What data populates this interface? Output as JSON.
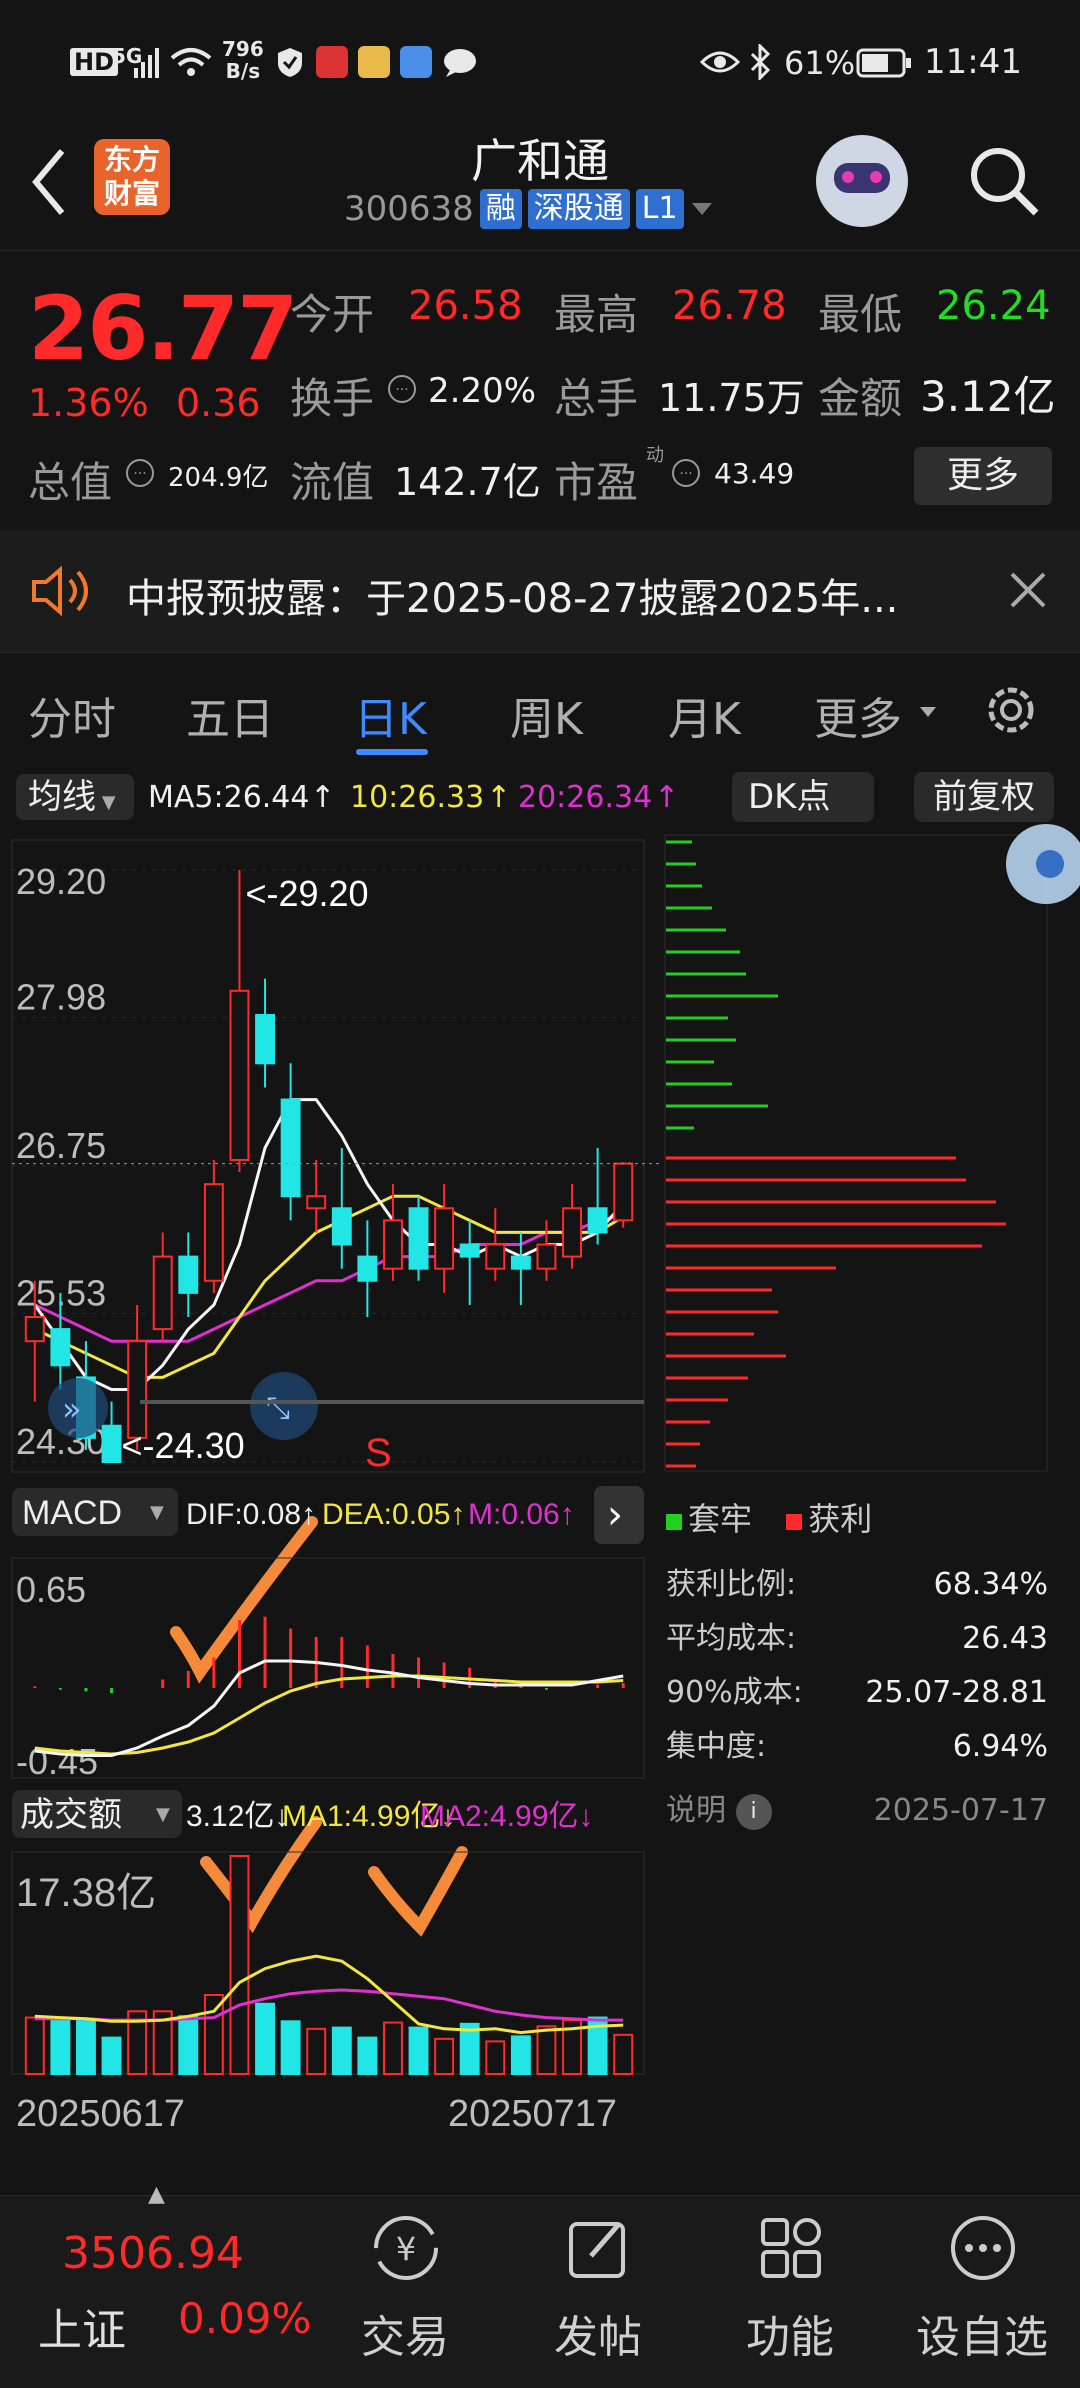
{
  "status_bar": {
    "time": "11:41",
    "battery": "61%",
    "net_speed_value": "796",
    "net_speed_unit": "B/s",
    "hd": "HD",
    "signal": "5G"
  },
  "header": {
    "logo_line1": "东方",
    "logo_line2": "财富",
    "stock_name": "广和通",
    "stock_code": "300638",
    "tag_rong": "融",
    "tag_sgt": "深股通",
    "tag_level": "L1"
  },
  "quote": {
    "price": "26.77",
    "change_pct": "1.36%",
    "change_amt": "0.36",
    "open_label": "今开",
    "open_value": "26.58",
    "high_label": "最高",
    "high_value": "26.78",
    "low_label": "最低",
    "low_value": "26.24",
    "turnover_label": "换手",
    "turnover_value": "2.20%",
    "volume_label": "总手",
    "volume_value": "11.75万",
    "amount_label": "金额",
    "amount_value": "3.12亿",
    "mktcap_label": "总值",
    "mktcap_value": "204.9亿",
    "float_label": "流值",
    "float_value": "142.7亿",
    "pe_label": "市盈",
    "pe_sup": "动",
    "pe_value": "43.49",
    "more_button": "更多"
  },
  "notice": {
    "text": "中报预披露：于2025-08-27披露2025年..."
  },
  "tabs": [
    "分时",
    "五日",
    "日K",
    "周K",
    "月K",
    "更多"
  ],
  "active_tab": 2,
  "kline": {
    "indicator_select": "均线",
    "ma5": "MA5:26.44",
    "ma10": "10:26.33",
    "ma20": "20:26.34",
    "dk_button": "DK点",
    "fq_button": "前复权",
    "y_ticks": [
      "29.20",
      "27.98",
      "26.75",
      "25.53",
      "24.30"
    ],
    "high_marker": "<-29.20",
    "low_marker": "<-24.30",
    "signal_s": "S",
    "dif_row": "DIF:0.08",
    "dea_row": "DEA:0.05",
    "m_row": "M:0.06",
    "macd_select": "MACD",
    "macd_ticks": [
      "0.65",
      "-0.45"
    ],
    "vol_select": "成交额",
    "vol_value": "3.12亿",
    "vol_ma1": "MA1:4.99亿",
    "vol_ma2": "MA2:4.99亿",
    "vol_tick": "17.38亿",
    "date_start": "20250617",
    "date_end": "20250717"
  },
  "chart_data": {
    "type": "candlestick",
    "candles": [
      {
        "o": 25.3,
        "c": 25.5,
        "h": 25.8,
        "l": 24.8
      },
      {
        "o": 25.4,
        "c": 25.1,
        "h": 25.7,
        "l": 24.9
      },
      {
        "o": 25.0,
        "c": 24.5,
        "h": 25.3,
        "l": 24.4
      },
      {
        "o": 24.6,
        "c": 24.3,
        "h": 24.8,
        "l": 24.3
      },
      {
        "o": 24.5,
        "c": 25.3,
        "h": 25.6,
        "l": 24.4
      },
      {
        "o": 25.4,
        "c": 26.0,
        "h": 26.2,
        "l": 25.3
      },
      {
        "o": 26.0,
        "c": 25.7,
        "h": 26.2,
        "l": 25.5
      },
      {
        "o": 25.8,
        "c": 26.6,
        "h": 26.8,
        "l": 25.7
      },
      {
        "o": 26.8,
        "c": 28.2,
        "h": 29.2,
        "l": 26.7
      },
      {
        "o": 28.0,
        "c": 27.6,
        "h": 28.3,
        "l": 27.4
      },
      {
        "o": 27.3,
        "c": 26.5,
        "h": 27.6,
        "l": 26.3
      },
      {
        "o": 26.4,
        "c": 26.5,
        "h": 26.8,
        "l": 26.2
      },
      {
        "o": 26.4,
        "c": 26.1,
        "h": 26.9,
        "l": 25.9
      },
      {
        "o": 26.0,
        "c": 25.8,
        "h": 26.3,
        "l": 25.5
      },
      {
        "o": 25.9,
        "c": 26.3,
        "h": 26.6,
        "l": 25.8
      },
      {
        "o": 26.4,
        "c": 25.9,
        "h": 26.5,
        "l": 25.8
      },
      {
        "o": 25.9,
        "c": 26.4,
        "h": 26.6,
        "l": 25.7
      },
      {
        "o": 26.1,
        "c": 26.0,
        "h": 26.3,
        "l": 25.6
      },
      {
        "o": 25.9,
        "c": 26.1,
        "h": 26.4,
        "l": 25.8
      },
      {
        "o": 26.0,
        "c": 25.9,
        "h": 26.2,
        "l": 25.6
      },
      {
        "o": 25.9,
        "c": 26.1,
        "h": 26.3,
        "l": 25.8
      },
      {
        "o": 26.0,
        "c": 26.4,
        "h": 26.6,
        "l": 25.9
      },
      {
        "o": 26.4,
        "c": 26.2,
        "h": 26.9,
        "l": 26.1
      },
      {
        "o": 26.3,
        "c": 26.77,
        "h": 26.78,
        "l": 26.24
      }
    ],
    "volume": [
      4.5,
      4.3,
      4.4,
      2.9,
      5.0,
      5.0,
      4.6,
      6.3,
      17.38,
      5.6,
      4.2,
      3.6,
      3.7,
      2.9,
      4.1,
      3.7,
      2.8,
      4.0,
      2.6,
      3.0,
      3.8,
      4.3,
      4.5,
      3.12
    ],
    "ylim": [
      24.3,
      29.2
    ],
    "ma5": [
      25.6,
      25.3,
      25.0,
      24.9,
      24.9,
      25.1,
      25.4,
      25.6,
      26.1,
      26.9,
      27.3,
      27.3,
      27.0,
      26.6,
      26.3,
      26.1,
      26.1,
      26.0,
      26.1,
      26.0,
      26.1,
      26.1,
      26.2,
      26.44
    ],
    "ma10": [
      25.4,
      25.3,
      25.2,
      25.1,
      25.0,
      25.0,
      25.1,
      25.2,
      25.5,
      25.8,
      26.0,
      26.2,
      26.3,
      26.4,
      26.5,
      26.5,
      26.4,
      26.3,
      26.2,
      26.2,
      26.2,
      26.2,
      26.2,
      26.33
    ],
    "ma20": [
      25.6,
      25.5,
      25.4,
      25.3,
      25.3,
      25.3,
      25.3,
      25.4,
      25.5,
      25.6,
      25.7,
      25.8,
      25.8,
      25.9,
      26.0,
      26.0,
      26.0,
      26.1,
      26.1,
      26.1,
      26.2,
      26.2,
      26.3,
      26.34
    ]
  },
  "chips": {
    "legend_trap": "套牢",
    "legend_profit": "获利",
    "rows": [
      {
        "label": "获利比例:",
        "value": "68.34%"
      },
      {
        "label": "平均成本:",
        "value": "26.43"
      },
      {
        "label": "90%成本:",
        "value": "25.07-28.81"
      },
      {
        "label": "集中度:",
        "value": "6.94%"
      }
    ],
    "note_label": "说明",
    "date": "2025-07-17"
  },
  "bottom_nav": {
    "index_value": "3506.94",
    "index_name": "上证",
    "index_change": "0.09%",
    "items": [
      "交易",
      "发帖",
      "功能",
      "设自选"
    ]
  },
  "colors": {
    "up": "#ff2a2a",
    "down": "#22e5e5",
    "accent": "#3d8bff",
    "annotation": "#f58a3a"
  }
}
